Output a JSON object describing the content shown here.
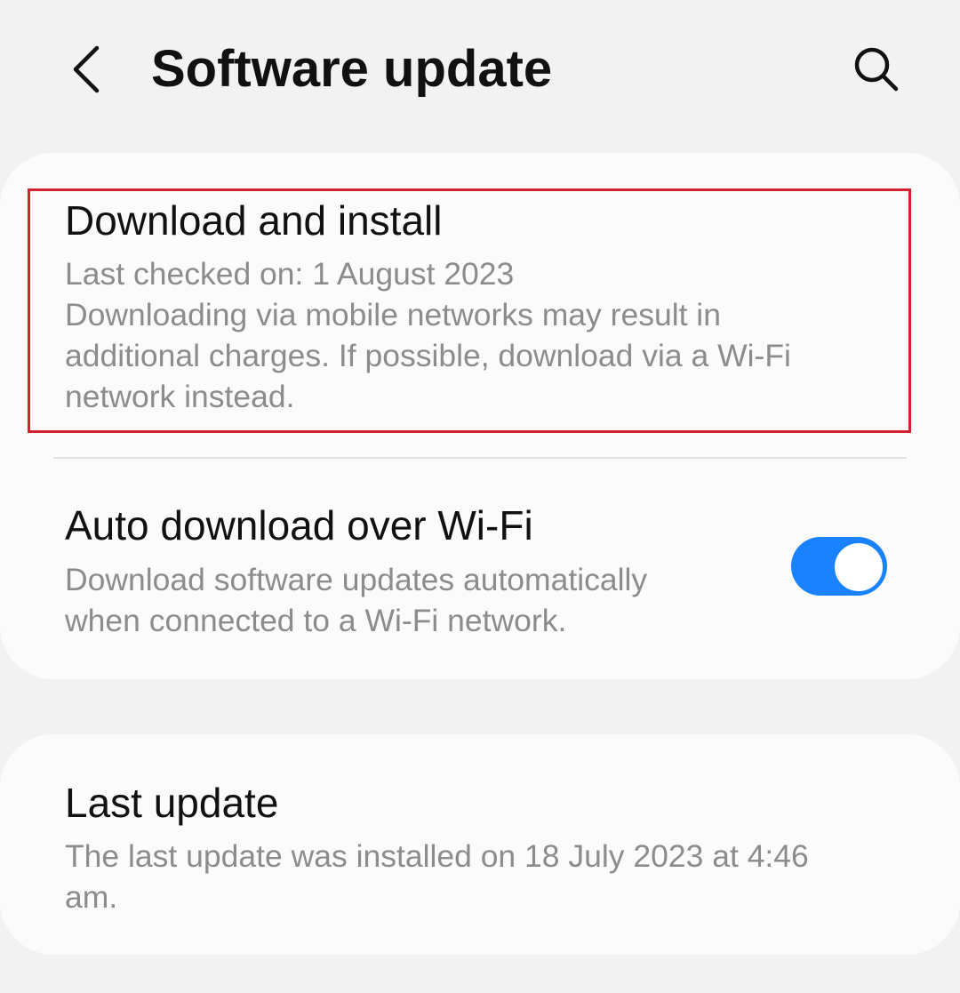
{
  "header": {
    "title": "Software update",
    "back_icon": "chevron-left-icon",
    "search_icon": "search-icon"
  },
  "settings": {
    "download_install": {
      "title": "Download and install",
      "subtitle_lines": [
        "Last checked on: 1 August 2023",
        "Downloading via mobile networks may result in",
        "additional charges. If possible, download via a Wi-Fi",
        "network instead."
      ]
    },
    "auto_download": {
      "title": "Auto download over Wi-Fi",
      "subtitle_lines": [
        "Download software updates automatically",
        "when connected to a Wi-Fi network."
      ],
      "enabled": true
    },
    "last_update": {
      "title": "Last update",
      "subtitle_lines": [
        "The last update was installed on 18 July 2023 at 4:46",
        "am."
      ]
    }
  },
  "colors": {
    "background": "#f2f2f2",
    "card": "#fbfbfb",
    "highlight": "#d2222d",
    "toggle_on": "#1a82ff",
    "title_text": "#111111",
    "subtitle_text": "#8c8c8c"
  }
}
